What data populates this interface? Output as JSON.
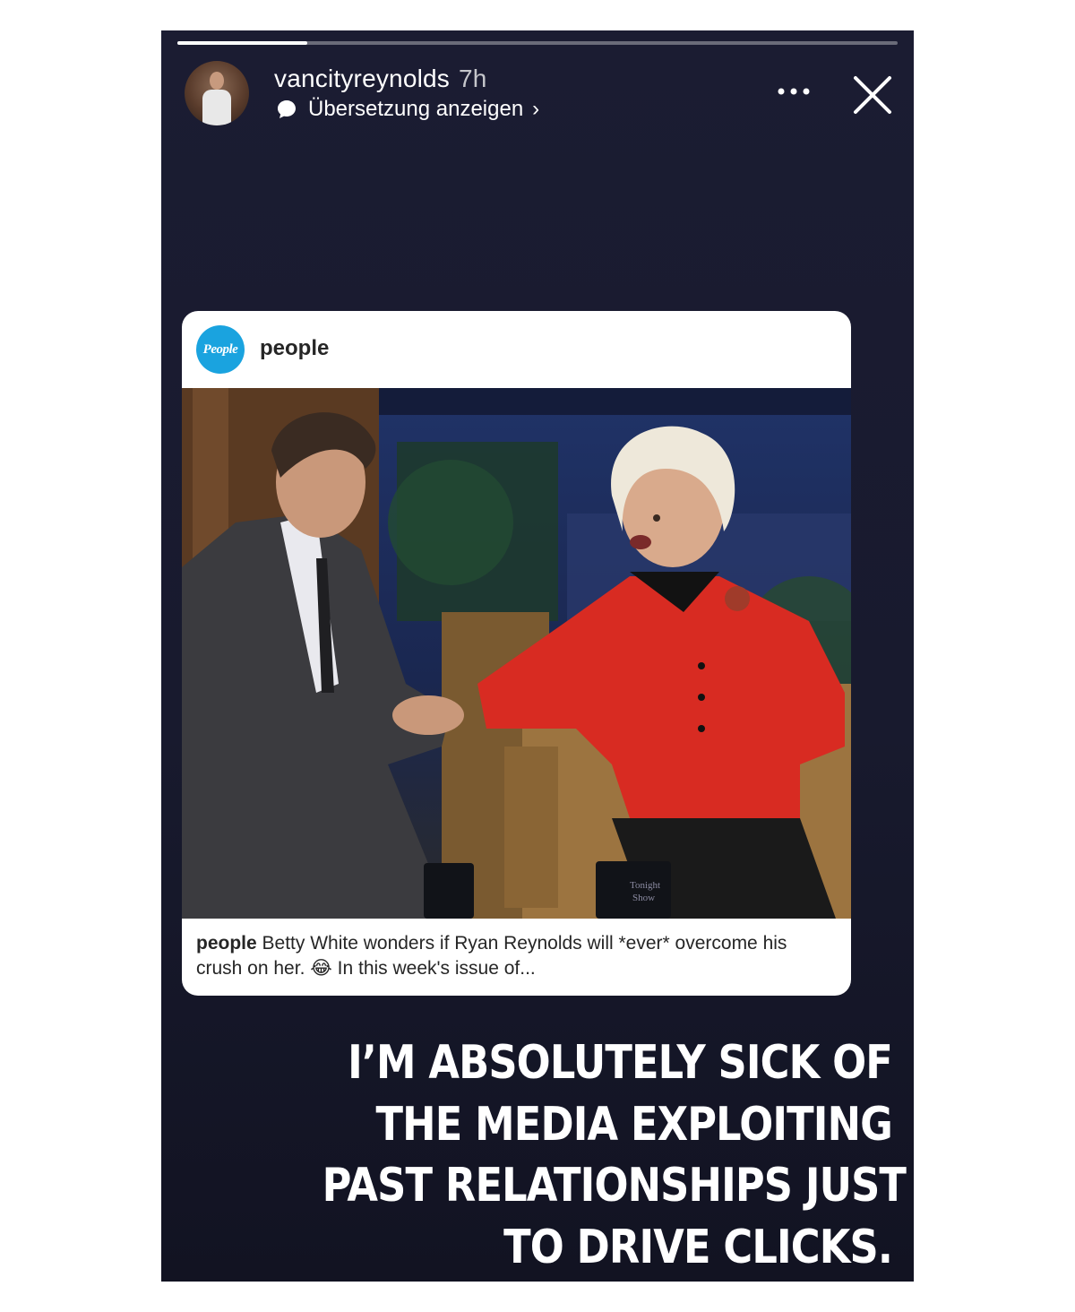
{
  "story": {
    "progress": 0.18,
    "username": "vancityreynolds",
    "time": "7h",
    "translate_label": "Übersetzung anzeigen",
    "translate_chevron": "›"
  },
  "shared_post": {
    "logo_text": "People",
    "account": "people",
    "caption_account": "people",
    "caption_text_1": " Betty White wonders if Ryan Reynolds will *ever* overcome his crush on her. ",
    "caption_emoji": "😂",
    "caption_text_2": "  In this week's issue of...",
    "mug_text_1": "Tonight",
    "mug_text_2": "Show"
  },
  "headline": {
    "lines": [
      "I’M ABSOLUTELY SICK OF",
      "THE MEDIA EXPLOITING",
      "PAST RELATIONSHIPS JUST",
      "TO DRIVE CLICKS."
    ]
  },
  "icons": {
    "avatar": "avatar",
    "translate": "speech-bubble-icon",
    "more": "more-options-icon",
    "close": "close-icon"
  },
  "colors": {
    "story_background": "#1b1c32",
    "people_blue": "#1aa3df",
    "jacket_red": "#d82b22"
  }
}
